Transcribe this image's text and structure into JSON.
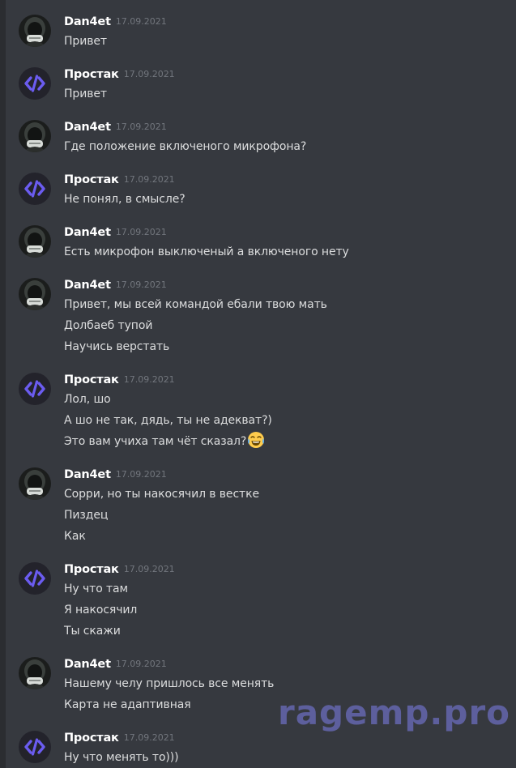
{
  "messages": [
    {
      "author": "Dan4et",
      "avatar": "dark-hood-avatar",
      "timestamp": "17.09.2021",
      "lines": [
        "Привет"
      ]
    },
    {
      "author": "Простак",
      "avatar": "code-brackets-avatar",
      "timestamp": "17.09.2021",
      "lines": [
        "Привет"
      ]
    },
    {
      "author": "Dan4et",
      "avatar": "dark-hood-avatar",
      "timestamp": "17.09.2021",
      "lines": [
        "Где положение включеного микрофона?"
      ]
    },
    {
      "author": "Простак",
      "avatar": "code-brackets-avatar",
      "timestamp": "17.09.2021",
      "lines": [
        "Не понял, в смысле?"
      ]
    },
    {
      "author": "Dan4et",
      "avatar": "dark-hood-avatar",
      "timestamp": "17.09.2021",
      "lines": [
        "Есть микрофон выключеный а включеного нету"
      ]
    },
    {
      "author": "Dan4et",
      "avatar": "dark-hood-avatar",
      "timestamp": "17.09.2021",
      "lines": [
        "Привет, мы всей командой ебали твою мать",
        "Долбаеб тупой",
        "Научись верстать"
      ]
    },
    {
      "author": "Простак",
      "avatar": "code-brackets-avatar",
      "timestamp": "17.09.2021",
      "lines": [
        "Лол, шо",
        "А шо не так, дядь, ты не адекват?)",
        "Это вам учиха там чёт сказал?"
      ],
      "emoji": "joy-emoji"
    },
    {
      "author": "Dan4et",
      "avatar": "dark-hood-avatar",
      "timestamp": "17.09.2021",
      "lines": [
        "Сорри, но ты накосячил в вестке",
        "Пиздец",
        "Как"
      ]
    },
    {
      "author": "Простак",
      "avatar": "code-brackets-avatar",
      "timestamp": "17.09.2021",
      "lines": [
        "Ну что там",
        "Я накосячил",
        "Ты скажи"
      ]
    },
    {
      "author": "Dan4et",
      "avatar": "dark-hood-avatar",
      "timestamp": "17.09.2021",
      "lines": [
        "Нашему челу пришлось все менять",
        "Карта не адаптивная"
      ]
    },
    {
      "author": "Простак",
      "avatar": "code-brackets-avatar",
      "timestamp": "17.09.2021",
      "lines": [
        "Ну что менять то)))"
      ]
    }
  ],
  "watermark": "ragemp.pro",
  "colors": {
    "background": "#36393f",
    "author": "#ffffff",
    "timestamp": "#72767d",
    "text": "#dcddde",
    "code_avatar_bg": "#23232b",
    "code_avatar_fg": "#6b5cf0",
    "watermark": "#7d80eb"
  }
}
